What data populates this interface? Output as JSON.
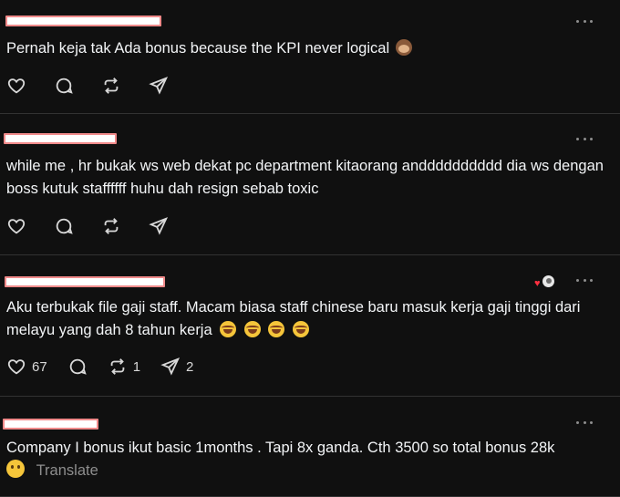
{
  "posts": [
    {
      "text": "Pernah keja tak Ada bonus because the KPI never logical",
      "emoji": "see-no-evil-monkey",
      "actions": {
        "likes": "",
        "replies": "",
        "reposts": "",
        "shares": ""
      }
    },
    {
      "text": "while me , hr bukak ws web dekat pc department kitaorang andddddddddd dia ws dengan boss kutuk staffffff huhu dah resign sebab toxic",
      "actions": {
        "likes": "",
        "replies": "",
        "reposts": "",
        "shares": ""
      }
    },
    {
      "text": "Aku terbukak file gaji staff. Macam biasa staff chinese baru masuk kerja gaji tinggi dari melayu yang dah 8 tahun kerja",
      "emoji": "rolling-on-floor-laughing x4",
      "actions": {
        "likes": "67",
        "replies": "",
        "reposts": "1",
        "shares": "2"
      }
    },
    {
      "text": "Company I bonus ikut basic 1months . Tapi 8x ganda. Cth 3500 so total bonus 28k",
      "emoji": "hushed-face",
      "translate_label": "Translate"
    }
  ],
  "colors": {
    "background": "#101010",
    "text": "#f3f5f7",
    "muted": "#8e8e8e",
    "divider": "#323232",
    "like": "#ff3040",
    "redaction": "#f08a8a"
  }
}
